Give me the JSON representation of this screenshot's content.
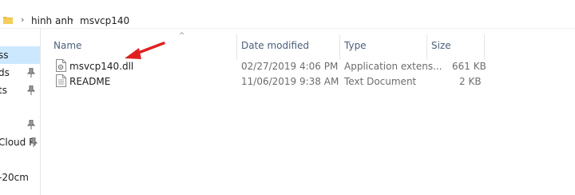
{
  "window": {
    "breadcrumb": [
      "hinh anh",
      "msvcp140"
    ]
  },
  "navigation": {
    "items": [
      {
        "label": "ss",
        "selected": true,
        "pinned": false
      },
      {
        "label": "ds",
        "selected": false,
        "pinned": true
      },
      {
        "label": "ts",
        "selected": false,
        "pinned": true
      },
      {
        "label": "",
        "selected": false,
        "pinned": true
      },
      {
        "label": "Cloud Fi",
        "selected": false,
        "pinned": true
      },
      {
        "label": "-20cm",
        "selected": false,
        "pinned": false
      }
    ]
  },
  "file_list": {
    "columns": [
      "Name",
      "Date modified",
      "Type",
      "Size"
    ],
    "sort_column": "Name",
    "rows": [
      {
        "name": "msvcp140.dll",
        "date_modified": "02/27/2019 4:06 PM",
        "type": "Application extens...",
        "size": "661 KB",
        "icon": "dll-file-icon"
      },
      {
        "name": "README",
        "date_modified": "11/06/2019 9:38 AM",
        "type": "Text Document",
        "size": "2 KB",
        "icon": "text-file-icon"
      }
    ]
  },
  "annotation": {
    "arrow_color": "#e02020"
  },
  "colors": {
    "selection": "#cce8ff",
    "header_text": "#4c607a",
    "folder": "#e8b93c"
  }
}
